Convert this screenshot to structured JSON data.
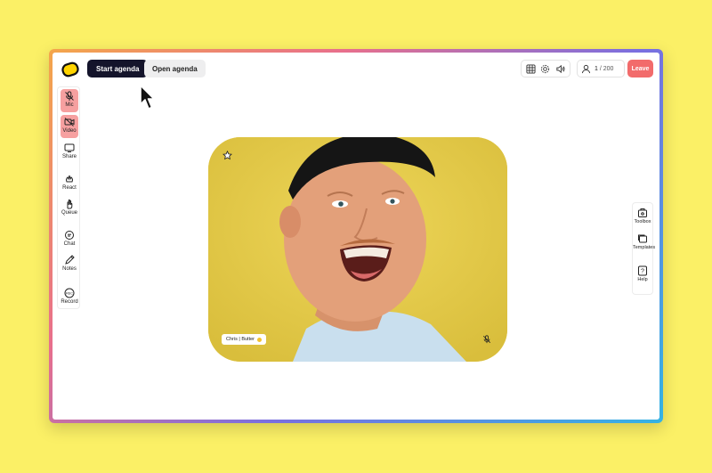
{
  "topbar": {
    "start_agenda_label": "Start agenda",
    "open_agenda_label": "Open agenda",
    "participants_current": "1",
    "participants_max": "/ 200",
    "leave_label": "Leave"
  },
  "sidebar": {
    "items": [
      {
        "label": "Mic",
        "icon": "mic-off-icon",
        "state": "off"
      },
      {
        "label": "Video",
        "icon": "video-off-icon",
        "state": "off"
      },
      {
        "label": "Share",
        "icon": "share-screen-icon"
      },
      {
        "label": "React",
        "icon": "react-icon"
      },
      {
        "label": "Queue",
        "icon": "hand-icon"
      },
      {
        "label": "Chat",
        "icon": "chat-icon"
      },
      {
        "label": "Notes",
        "icon": "pencil-icon"
      },
      {
        "label": "Record",
        "icon": "record-icon"
      }
    ]
  },
  "right_sidebar": {
    "items": [
      {
        "label": "Toolbox",
        "icon": "toolbox-icon"
      },
      {
        "label": "Templates",
        "icon": "templates-icon"
      },
      {
        "label": "Help",
        "icon": "help-icon"
      }
    ]
  },
  "video_tile": {
    "participant_name": "Chris | Butter",
    "mic_state": "muted"
  },
  "colors": {
    "background": "#fbf066",
    "primary_button": "#14142b",
    "leave_button": "#f26b6b",
    "active_off": "#f6a0a0"
  }
}
